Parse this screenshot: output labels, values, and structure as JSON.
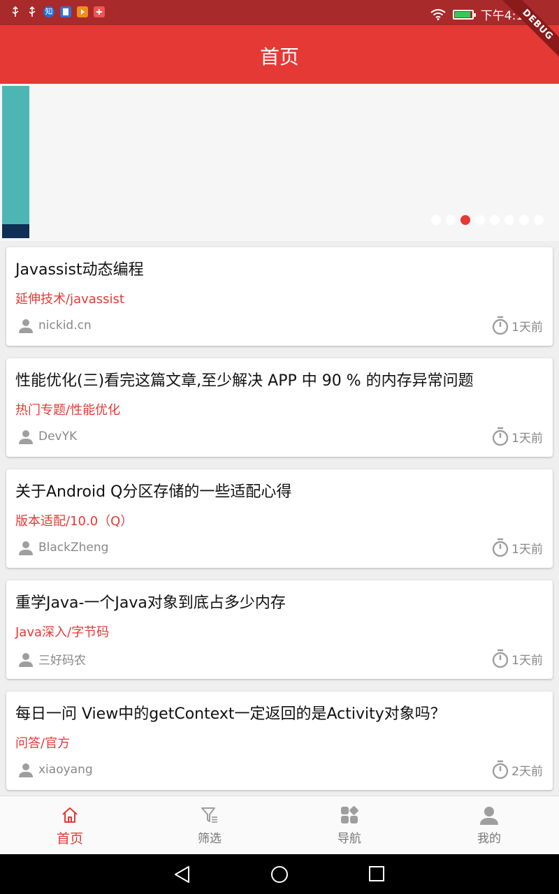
{
  "status_bar": {
    "time": "下午4:10",
    "notification_icons": [
      "usb-icon",
      "usb-icon",
      "zhihu-icon",
      "reader-icon",
      "player-icon",
      "plus-icon"
    ],
    "zhihu_label": "知",
    "colors": {
      "background": "#a82a2a",
      "battery_fill": "#38c85a"
    }
  },
  "app_bar": {
    "title": "首页",
    "debug_label": "DEBUG",
    "color": "#e53935"
  },
  "banner": {
    "dot_count": 8,
    "active_dot_index": 2
  },
  "articles": [
    {
      "title": "Javassist动态编程",
      "category": "延伸技术/javassist",
      "author": "nickid.cn",
      "time": "1天前"
    },
    {
      "title": "性能优化(三)看完这篇文章,至少解决 APP 中 90 % 的内存异常问题",
      "category": "热门专题/性能优化",
      "author": "DevYK",
      "time": "1天前"
    },
    {
      "title": "关于Android Q分区存储的一些适配心得",
      "category": "版本适配/10.0（Q）",
      "author": "BlackZheng",
      "time": "1天前"
    },
    {
      "title": "重学Java-一个Java对象到底占多少内存",
      "category": "Java深入/字节码",
      "author": "三好码农",
      "time": "1天前"
    },
    {
      "title": "每日一问 View中的getContext一定返回的是Activity对象吗？",
      "category": "问答/官方",
      "author": "xiaoyang",
      "time": "2天前"
    }
  ],
  "bottom_nav": [
    {
      "label": "首页",
      "icon": "home-icon",
      "active": true
    },
    {
      "label": "筛选",
      "icon": "filter-icon",
      "active": false
    },
    {
      "label": "导航",
      "icon": "apps-icon",
      "active": false
    },
    {
      "label": "我的",
      "icon": "person-icon",
      "active": false
    }
  ],
  "system_nav": {
    "buttons": [
      "back-icon",
      "home-circle-icon",
      "recents-icon"
    ]
  }
}
